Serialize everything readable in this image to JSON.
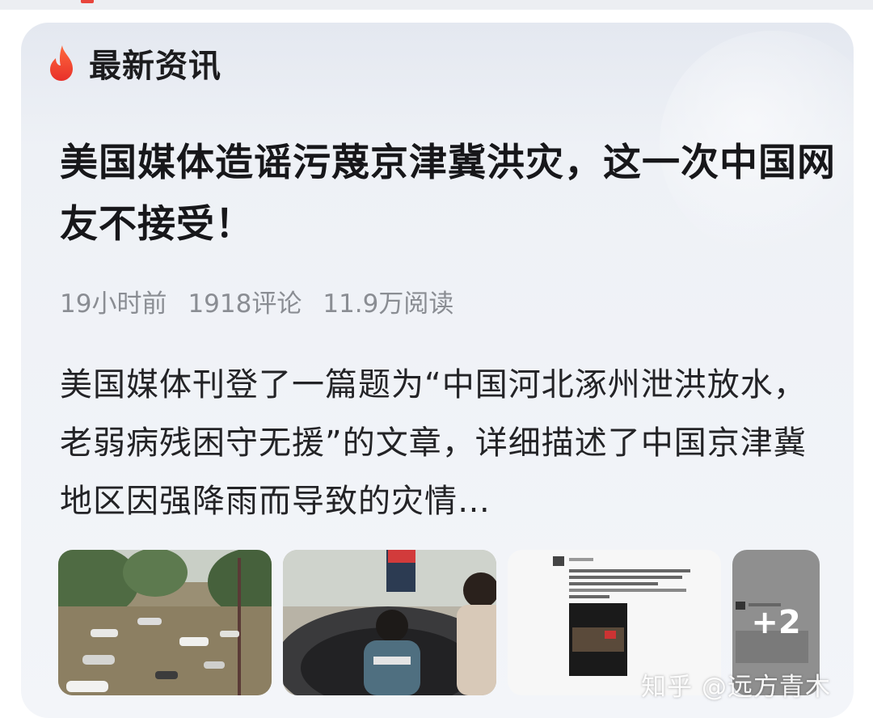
{
  "section": {
    "title": "最新资讯",
    "icon": "flame-icon"
  },
  "article": {
    "headline": "美国媒体造谣污蔑京津冀洪灾，这一次中国网友不接受！",
    "meta": {
      "time": "19小时前",
      "comments": "1918评论",
      "reads": "11.9万阅读"
    },
    "summary": "美国媒体刊登了一篇题为“中国河北涿州泄洪放水，老弱病残困守无援”的文章，详细描述了中国京津冀地区因强降雨而导致的灾情…"
  },
  "thumbnails": [
    {
      "name": "flooded-street-photo"
    },
    {
      "name": "rescue-boat-photo"
    },
    {
      "name": "social-post-screenshot"
    },
    {
      "name": "more-images",
      "more_label": "+2"
    }
  ],
  "watermark": "知乎 @远方青木",
  "colors": {
    "accent": "#e8453c",
    "text": "#17171a",
    "meta": "#8a8d93"
  }
}
